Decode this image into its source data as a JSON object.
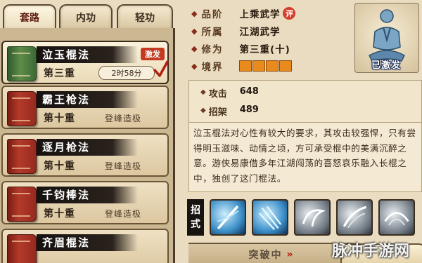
{
  "tabs": [
    {
      "label": "套路",
      "active": true
    },
    {
      "label": "内功",
      "active": false
    },
    {
      "label": "轻功",
      "active": false
    }
  ],
  "skills": [
    {
      "name": "泣玉棍法",
      "level": "第三重",
      "timer": "2时58分",
      "badge": "激发",
      "selected": true,
      "book_color": "green"
    },
    {
      "name": "霸王枪法",
      "level": "第十重",
      "status": "登峰造极",
      "book_color": "red"
    },
    {
      "name": "逐月枪法",
      "level": "第十重",
      "status": "登峰造极",
      "book_color": "red"
    },
    {
      "name": "千钧棒法",
      "level": "第十重",
      "status": "登峰造极",
      "book_color": "red"
    },
    {
      "name": "齐眉棍法",
      "book_color": "red"
    }
  ],
  "info": {
    "rank_label": "品阶",
    "rank_value": "上乘武学",
    "rank_tag": "评",
    "school_label": "所属",
    "school_value": "江湖武学",
    "cultivation_label": "修为",
    "cultivation_value": "第三重(十)",
    "realm_label": "境界",
    "realm_progress": 4
  },
  "portrait_label": "已激发",
  "stats": [
    {
      "label": "攻击",
      "value": "648"
    },
    {
      "label": "招架",
      "value": "489"
    }
  ],
  "description": "泣玉棍法对心性有较大的要求，其攻击较强悍，只有尝得明玉滋味、动情之顷，方可承受棍中的美满沉醉之意。游侠易康借多年江湖闯荡的喜怒哀乐融入长棍之中，独创了这门棍法。",
  "moves_label": [
    "招",
    "式"
  ],
  "moves": [
    {
      "icon": "blue-slash-icon"
    },
    {
      "icon": "blue-spear-icon"
    },
    {
      "icon": "grey-whirl-icon"
    },
    {
      "icon": "grey-strike-icon"
    },
    {
      "icon": "grey-sweep-icon"
    }
  ],
  "breakthrough_label": "突破中",
  "watermark": "脉冲手游网",
  "colors": {
    "accent": "#c33a20",
    "realm_bar": "#e88a1c"
  }
}
